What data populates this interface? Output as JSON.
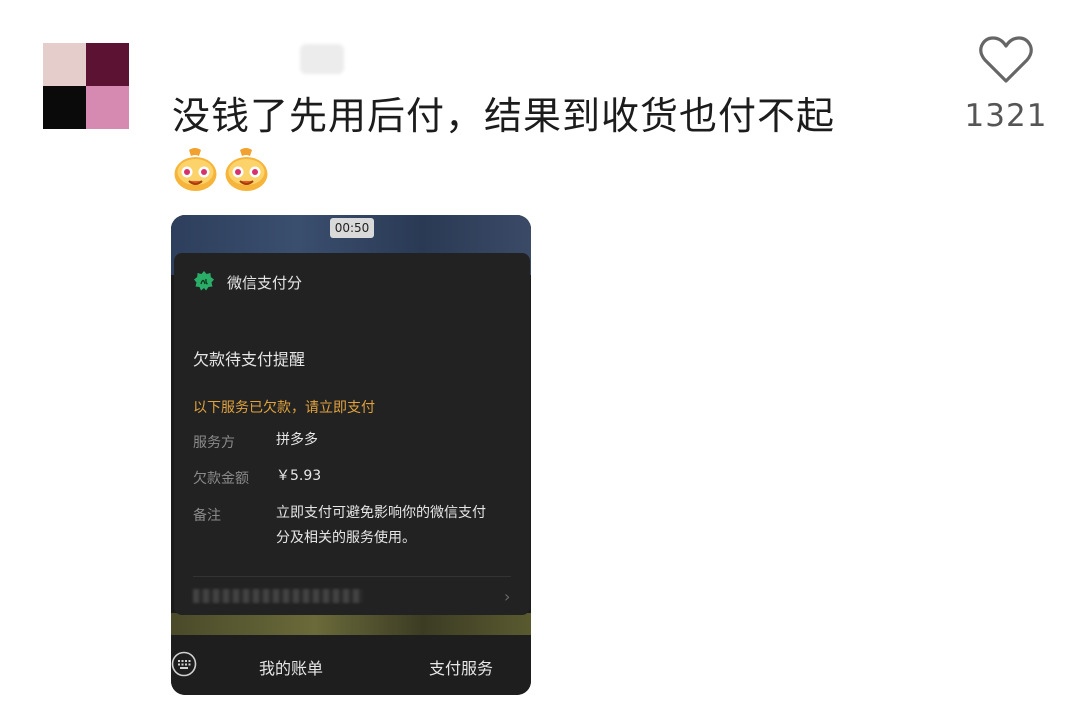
{
  "comment": {
    "text": "没钱了先用后付，结果到收货也付不起",
    "like_count": "1321"
  },
  "screenshot": {
    "timer": "00:50",
    "app_name": "微信支付分",
    "notice_title": "欠款待支付提醒",
    "warning": "以下服务已欠款，请立即支付",
    "rows": [
      {
        "label": "服务方",
        "value": "拼多多"
      },
      {
        "label": "欠款金额",
        "value": "￥5.93"
      },
      {
        "label": "备注",
        "value_line1": "立即支付可避免影响你的微信支付",
        "value_line2": "分及相关的服务使用。"
      }
    ],
    "bottom_menu": [
      "我的账单",
      "支付服务"
    ]
  },
  "icons": {
    "like": "heart-icon",
    "emoji": "grinning-money-bag-emoji",
    "app_logo": "wechat-pay-score-icon",
    "keyboard": "keyboard-icon",
    "chevron": "chevron-right-icon"
  },
  "colors": {
    "warning": "#e0a23d",
    "panel_bg": "#222222",
    "wx_green": "#2aae67"
  }
}
